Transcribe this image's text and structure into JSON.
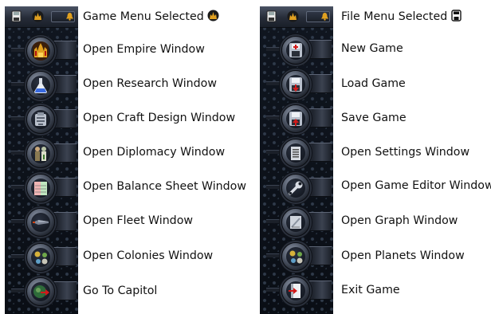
{
  "game_panel": {
    "title": "Game Menu Selected",
    "title_icon": "game-menu-icon",
    "items": [
      {
        "label": "Open Empire Window",
        "icon": "empire-palace-icon"
      },
      {
        "label": "Open Research Window",
        "icon": "flask-icon"
      },
      {
        "label": "Open Craft Design Window",
        "icon": "craft-design-icon"
      },
      {
        "label": "Open Diplomacy Window",
        "icon": "diplomats-icon"
      },
      {
        "label": "Open Balance Sheet Window",
        "icon": "balance-sheet-icon"
      },
      {
        "label": "Open Fleet Window",
        "icon": "fleet-ship-icon"
      },
      {
        "label": "Open Colonies Window",
        "icon": "colonies-icon"
      },
      {
        "label": "Go To Capitol",
        "icon": "capitol-arrow-icon"
      }
    ]
  },
  "file_panel": {
    "title": "File Menu Selected",
    "title_icon": "file-menu-icon",
    "items": [
      {
        "label": "New Game",
        "icon": "new-game-icon"
      },
      {
        "label": "Load Game",
        "icon": "load-game-icon"
      },
      {
        "label": "Save Game",
        "icon": "save-game-icon"
      },
      {
        "label": "Open Settings Window",
        "icon": "settings-icon"
      },
      {
        "label": "Open Game Editor Window",
        "icon": "wrench-icon"
      },
      {
        "label": "Open Graph Window",
        "icon": "graph-icon"
      },
      {
        "label": "Open Planets Window",
        "icon": "planets-icon"
      },
      {
        "label": "Exit Game",
        "icon": "exit-door-icon"
      }
    ]
  },
  "colors": {
    "panel_background": "#0a0e15",
    "button_metal": "#4b5362",
    "label_text": "#111111",
    "accent_red": "#d11a1a",
    "accent_gold": "#e0a020"
  }
}
